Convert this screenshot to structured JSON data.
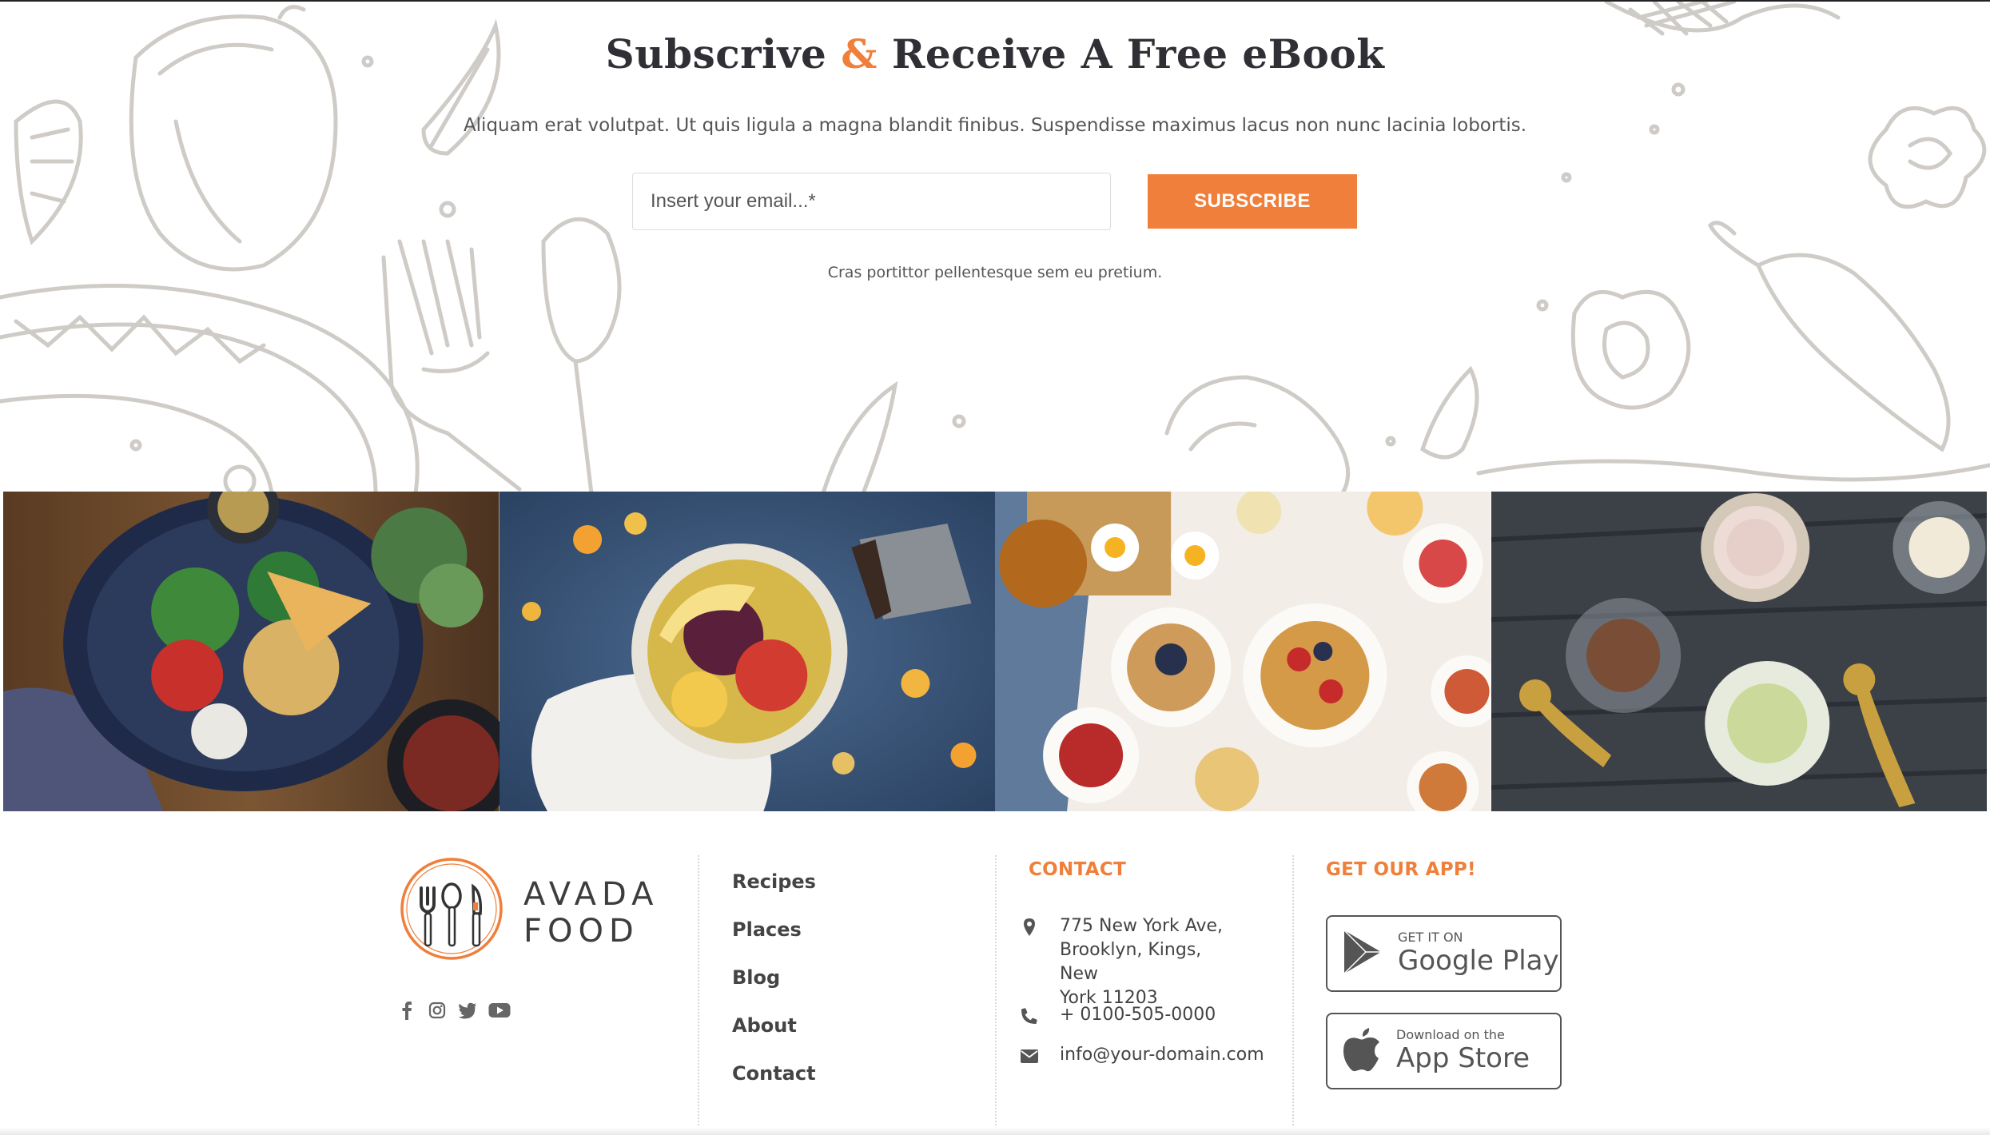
{
  "subscribe": {
    "title_part1": "Subscrive ",
    "title_amp": "&",
    "title_part2": " Receive A Free eBook",
    "description": "Aliquam erat volutpat. Ut quis ligula a magna blandit finibus. Suspendisse maximus lacus non nunc lacinia lobortis.",
    "email_placeholder": "Insert your email...*",
    "button_label": "SUBSCRIBE",
    "note": "Cras portittor pellentesque sem eu pretium."
  },
  "gallery": {
    "images": [
      {
        "name": "salad-bowl-photo",
        "icon": "bowl-with-chickpeas-and-vegetables"
      },
      {
        "name": "fruit-plate-photo",
        "icon": "fruit-bowl-with-banana"
      },
      {
        "name": "breakfast-table-photo",
        "icon": "waffles-and-eggs-breakfast"
      },
      {
        "name": "ice-cream-photo",
        "icon": "ice-cream-scoops-in-bowls"
      }
    ]
  },
  "footer": {
    "logo_line1": "AVADA",
    "logo_line2": "FOOD",
    "social_icons": [
      "facebook-icon",
      "instagram-icon",
      "twitter-icon",
      "youtube-icon"
    ],
    "nav": [
      "Recipes",
      "Places",
      "Blog",
      "About",
      "Contact"
    ],
    "contact_title": "CONTACT",
    "address": "775 New York Ave, Brooklyn, Kings, New York 11203",
    "address_lines": [
      "775 New York Ave,",
      "Brooklyn, Kings, New",
      "York 11203"
    ],
    "phone": "+ 0100-505-0000",
    "email": "info@your-domain.com",
    "app_title": "GET OUR APP!",
    "google_small": "GET IT ON",
    "google_big": "Google Play",
    "apple_small": "Download on the",
    "apple_big": "App Store"
  },
  "colors": {
    "accent": "#ef7f3a",
    "heading": "#2f2f35",
    "text": "#444444",
    "doodle": "#cfcbc6"
  }
}
